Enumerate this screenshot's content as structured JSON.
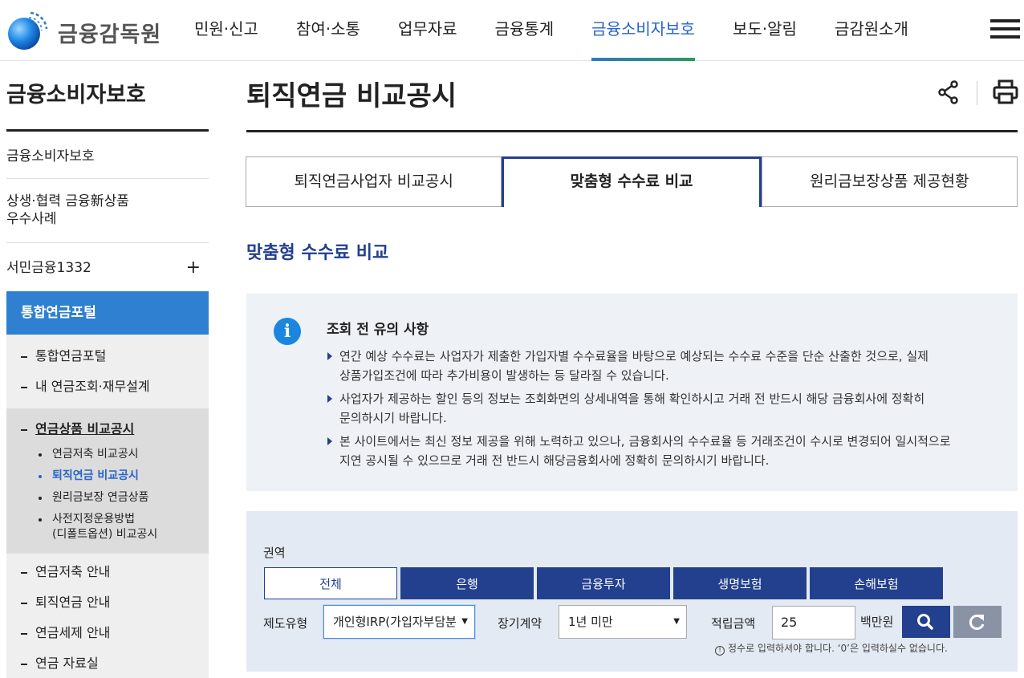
{
  "header": {
    "logo_text": "금융감독원",
    "nav": [
      {
        "label": "민원·신고"
      },
      {
        "label": "참여·소통"
      },
      {
        "label": "업무자료"
      },
      {
        "label": "금융통계"
      },
      {
        "label": "금융소비자보호"
      },
      {
        "label": "보도·알림"
      },
      {
        "label": "금감원소개"
      }
    ],
    "active_index": 4,
    "accent_color": "#2864c8"
  },
  "sidebar": {
    "title": "금융소비자보호",
    "items": [
      {
        "label": "금융소비자보호"
      },
      {
        "label": "상생·협력 금융新상품",
        "label2": "우수사례"
      },
      {
        "label": "서민금융1332",
        "expand": "+"
      }
    ],
    "blue_label": "통합연금포털",
    "sub_top": [
      "통합연금포털",
      "내 연금조회·재무설계"
    ],
    "sub_active": {
      "label": "연금상품 비교공시",
      "children": [
        "연금저축 비교공시",
        "퇴직연금 비교공시",
        "원리금보장 연금상품",
        "사전지정운용방법",
        "(디폴트옵션) 비교공시"
      ]
    },
    "sub_bottom": [
      "연금저축 안내",
      "퇴직연금 안내",
      "연금세제 안내",
      "연금 자료실"
    ]
  },
  "main": {
    "page_title": "퇴직연금 비교공시",
    "tabs": [
      {
        "label": "퇴직연금사업자 비교공시"
      },
      {
        "label": "맞춤형 수수료 비교"
      },
      {
        "label": "원리금보장상품 제공현황"
      }
    ],
    "active_tab": 1,
    "section_title": "맞춤형 수수료 비교",
    "notice": {
      "title": "조회 전 유의 사항",
      "items": [
        {
          "line1": "연간 예상 수수료는 사업자가 제출한 가입자별 수수료율을 바탕으로 예상되는 수수료 수준을 단순 산출한 것으로, 실제",
          "line2": "상품가입조건에 따라 추가비용이 발생하는 등 달라질 수 있습니다."
        },
        {
          "line1": "사업자가 제공하는 할인 등의 정보는 조회화면의 상세내역을 통해 확인하시고 거래 전 반드시 해당 금융회사에 정확히",
          "line2": "문의하시기 바랍니다."
        },
        {
          "line1": "본 사이트에서는 최신 정보 제공을 위해 노력하고 있으나, 금융회사의 수수료율 등 거래조건이 수시로 변경되어 일시적으로",
          "line2": "지연 공시될 수 있으므로 거래 전 반드시 해당금융회사에 정확히 문의하시기 바랍니다."
        }
      ]
    },
    "search": {
      "region_label": "권역",
      "regions": [
        "전체",
        "은행",
        "금융투자",
        "생명보험",
        "손해보험"
      ],
      "selected_region": 0,
      "plan_type_label": "제도유형",
      "plan_type_value": "개인형IRP(가입자부담분",
      "long_term_label": "장기계약",
      "long_term_value": "1년 미만",
      "amount_label": "적립금액",
      "amount_value": "25",
      "amount_unit": "백만원",
      "hint": "정수로 입력하셔야 합니다. ‘0’은 입력하실수 없습니다.",
      "hint_icon": "!",
      "arrow": "▼"
    }
  }
}
